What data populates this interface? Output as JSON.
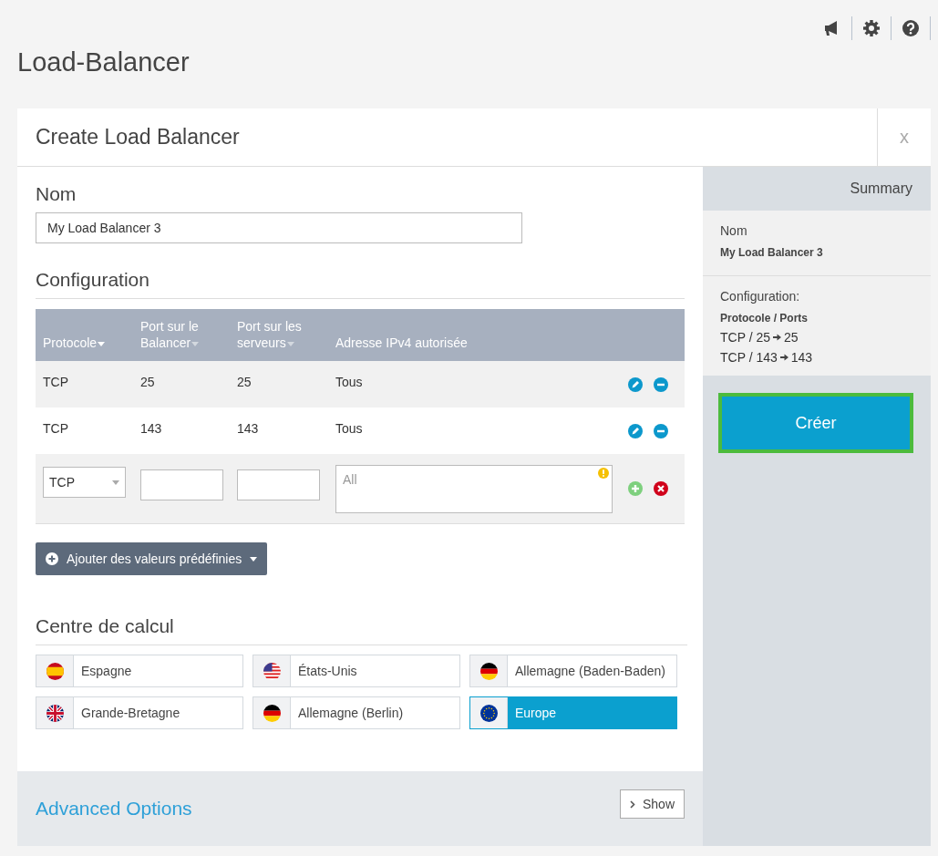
{
  "page": {
    "title": "Load-Balancer"
  },
  "dialog": {
    "title": "Create Load Balancer",
    "close": "x"
  },
  "name_section": {
    "heading": "Nom",
    "value": "My Load Balancer 3"
  },
  "configuration": {
    "heading": "Configuration",
    "columns": [
      {
        "label": "Protocole",
        "sortable": true
      },
      {
        "label": "Port sur le Balancer",
        "sortable": true
      },
      {
        "label": "Port sur les serveurs",
        "sortable": true
      },
      {
        "label": "Adresse IPv4 autorisée",
        "sortable": false
      }
    ],
    "rows": [
      {
        "protocol": "TCP",
        "balancer_port": "25",
        "server_port": "25",
        "address": "Tous"
      },
      {
        "protocol": "TCP",
        "balancer_port": "143",
        "server_port": "143",
        "address": "Tous"
      }
    ],
    "new_row": {
      "protocol": "TCP",
      "address_placeholder": "All",
      "warning": true
    },
    "predefined_button": "Ajouter des valeurs prédéfinies"
  },
  "datacenters": {
    "heading": "Centre de calcul",
    "items": [
      {
        "label": "Espagne",
        "kind": "es",
        "selected": false
      },
      {
        "label": "États-Unis",
        "kind": "us",
        "selected": false
      },
      {
        "label": "Allemagne (Baden-Baden)",
        "kind": "de",
        "selected": false
      },
      {
        "label": "Grande-Bretagne",
        "kind": "gb",
        "selected": false
      },
      {
        "label": "Allemagne (Berlin)",
        "kind": "de",
        "selected": false
      },
      {
        "label": "Europe",
        "kind": "eu",
        "selected": true
      }
    ]
  },
  "advanced": {
    "title": "Advanced Options",
    "button": "Show"
  },
  "summary": {
    "heading": "Summary",
    "name_label": "Nom",
    "name_value": "My Load Balancer 3",
    "config_label": "Configuration:",
    "ports_label": "Protocole / Ports",
    "ports": [
      {
        "from": "TCP / 25",
        "to": "25"
      },
      {
        "from": "TCP / 143",
        "to": "143"
      }
    ],
    "create_button": "Créer"
  }
}
